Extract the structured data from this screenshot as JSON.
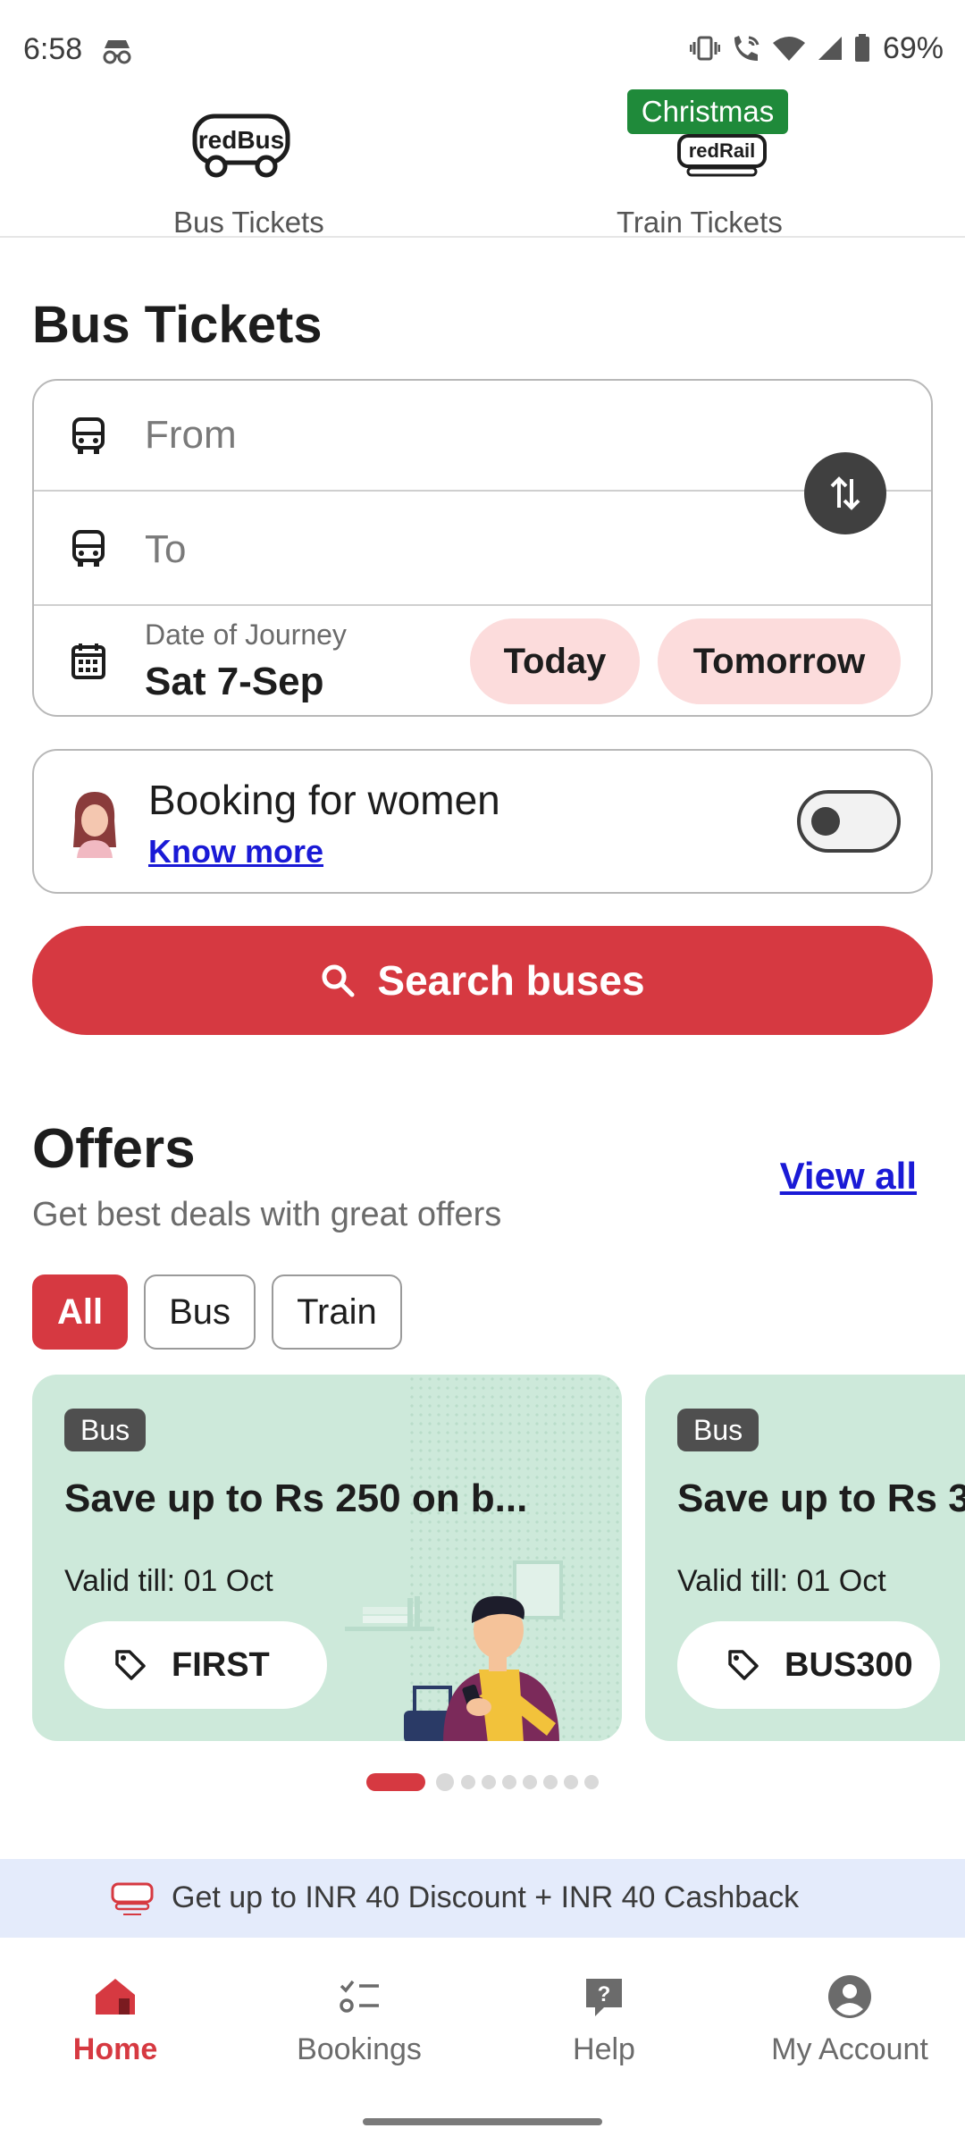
{
  "status_bar": {
    "time": "6:58",
    "battery": "69%"
  },
  "top_tabs": [
    {
      "label": "Bus Tickets",
      "logo": "redBus",
      "active": true
    },
    {
      "label": "Train Tickets",
      "logo": "redRail",
      "badge": "Christmas",
      "active": false
    }
  ],
  "page": {
    "title": "Bus Tickets"
  },
  "search": {
    "from_placeholder": "From",
    "to_placeholder": "To",
    "date_label": "Date of Journey",
    "date_value": "Sat 7-Sep",
    "chip_today": "Today",
    "chip_tomorrow": "Tomorrow"
  },
  "women_booking": {
    "title": "Booking for women",
    "link": "Know more",
    "toggle_on": false
  },
  "search_button": {
    "label": "Search buses"
  },
  "offers": {
    "title": "Offers",
    "subtitle": "Get best deals with great offers",
    "view_all": "View all",
    "filters": [
      "All",
      "Bus",
      "Train"
    ],
    "active_filter": "All",
    "cards": [
      {
        "tag": "Bus",
        "title": "Save up to Rs 250 on b...",
        "valid": "Valid till: 01 Oct",
        "code": "FIRST"
      },
      {
        "tag": "Bus",
        "title": "Save up to Rs 3",
        "valid": "Valid till: 01 Oct",
        "code": "BUS300"
      }
    ],
    "pager": {
      "current": 1,
      "total": 9
    }
  },
  "promo_banner": {
    "text": "Get up to INR 40 Discount + INR 40 Cashback"
  },
  "bottom_nav": [
    {
      "label": "Home",
      "icon": "home-icon",
      "active": true
    },
    {
      "label": "Bookings",
      "icon": "bookings-list-icon",
      "active": false
    },
    {
      "label": "Help",
      "icon": "help-icon",
      "active": false
    },
    {
      "label": "My Account",
      "icon": "account-icon",
      "active": false
    }
  ],
  "colors": {
    "brand_red": "#d63941",
    "chip_pink": "#fcdcdc",
    "offer_green": "#cde9da",
    "link_blue": "#1a1ad6",
    "christmas_green": "#1f8a3a"
  }
}
